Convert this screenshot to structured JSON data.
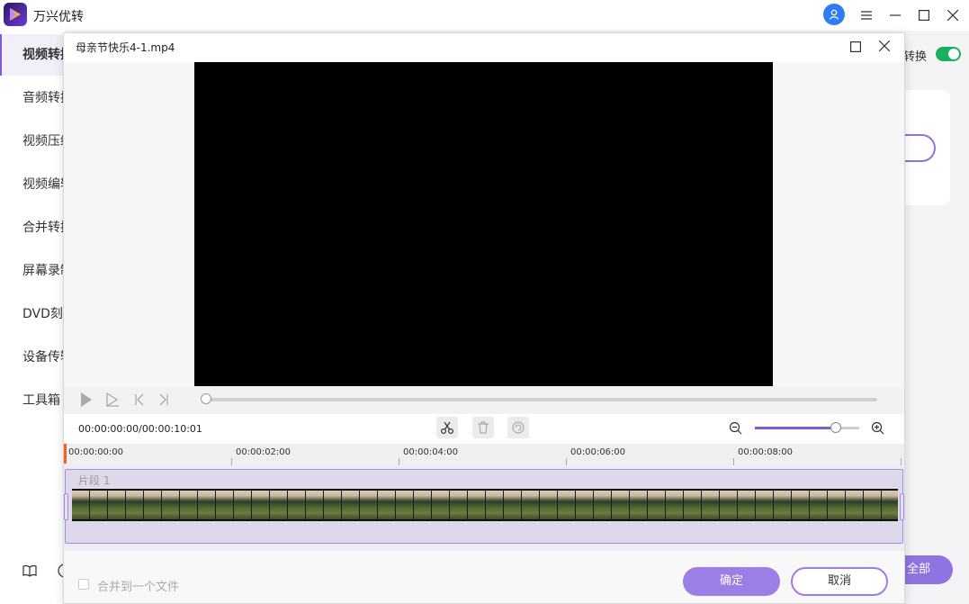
{
  "app": {
    "title": "万兴优转",
    "accent_color": "#7c5cd6"
  },
  "sidebar": {
    "items": [
      {
        "label": "视频转换",
        "active": true
      },
      {
        "label": "音频转换"
      },
      {
        "label": "视频压缩"
      },
      {
        "label": "视频编辑"
      },
      {
        "label": "合并转换"
      },
      {
        "label": "屏幕录制"
      },
      {
        "label": "DVD刻录"
      },
      {
        "label": "设备传输"
      },
      {
        "label": "工具箱"
      }
    ]
  },
  "background": {
    "convert_label": "转换",
    "convert_all_label": "全部"
  },
  "editor": {
    "file_name": "母亲节快乐4-1.mp4",
    "timecode": "00:00:00:00/00:00:10:01",
    "ruler_labels": [
      "00:00:00:00",
      "00:00:02:00",
      "00:00:04:00",
      "00:00:06:00",
      "00:00:08:00"
    ],
    "clip_label": "片段 1",
    "merge_label": "合并到一个文件",
    "confirm_label": "确定",
    "cancel_label": "取消",
    "progress": 0,
    "zoom_level": 0.78
  }
}
